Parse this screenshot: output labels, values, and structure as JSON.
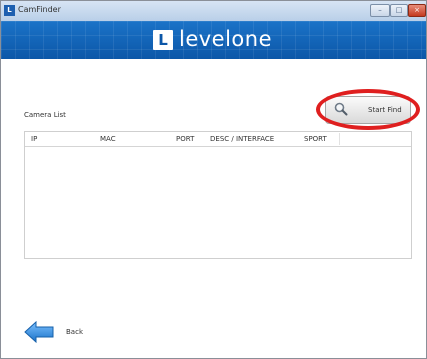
{
  "window": {
    "title": "CamFinder",
    "app_icon": "levelone-icon",
    "controls": [
      "minimize-icon",
      "maximize-icon",
      "close-icon"
    ]
  },
  "banner": {
    "logo_text": "levelone",
    "logo_mark": "levelone-mark-icon",
    "colors": {
      "background": "#0c57a8",
      "text": "#ffffff"
    }
  },
  "camera_list": {
    "label": "Camera List",
    "columns": [
      "IP",
      "MAC",
      "PORT",
      "DESC / INTERFACE",
      "SPORT"
    ],
    "rows": []
  },
  "actions": {
    "start_find_label": "Start Find",
    "start_find_icon": "magnifier-icon",
    "highlight_color": "#df1f1f",
    "back_label": "Back",
    "back_icon": "arrow-left-icon"
  }
}
